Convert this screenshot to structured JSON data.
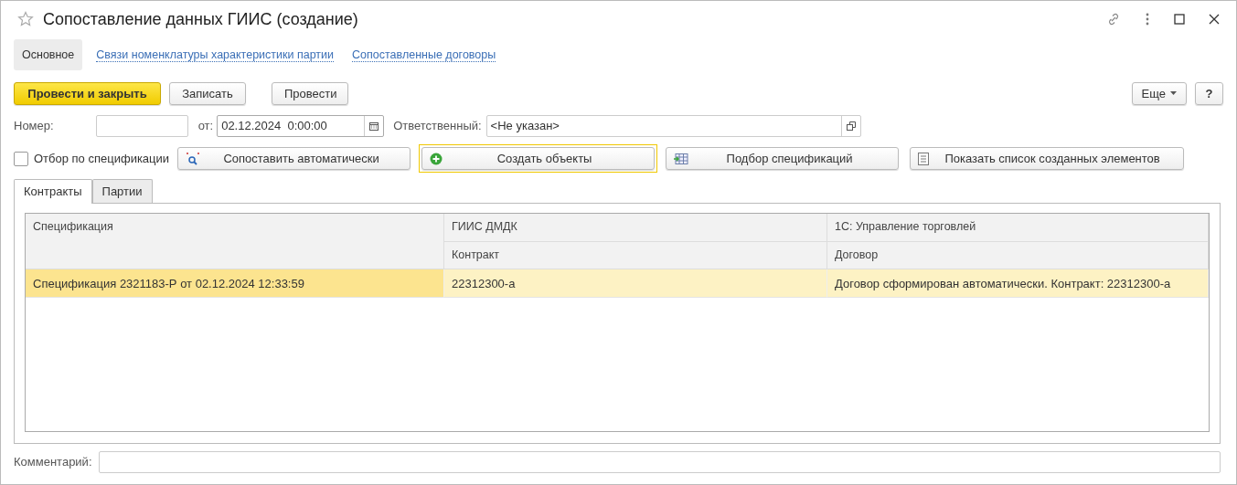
{
  "window": {
    "title": "Сопоставление данных ГИИС (создание)"
  },
  "sections": [
    {
      "label": "Основное",
      "selected": true
    },
    {
      "label": "Связи номенклатуры характеристики партии",
      "selected": false
    },
    {
      "label": "Сопоставленные договоры",
      "selected": false
    }
  ],
  "toolbar": {
    "buttons": [
      {
        "label": "Провести и закрыть",
        "kind": "primary"
      },
      {
        "label": "Записать",
        "kind": "normal"
      },
      {
        "label": "Провести",
        "kind": "normal"
      }
    ],
    "more": "Еще",
    "help": "?"
  },
  "fields": {
    "number": {
      "label": "Номер:"
    },
    "date": {
      "label": "от:",
      "value": "02.12.2024  0:00:00"
    },
    "responsible": {
      "label": "Ответственный:",
      "value": "<Не указан>"
    }
  },
  "filter": {
    "label": "Отбор по спецификации",
    "checked": false
  },
  "actions": [
    {
      "label": "Сопоставить автоматически",
      "kind": "match",
      "focused": false
    },
    {
      "label": "Создать объекты",
      "kind": "create",
      "focused": true
    },
    {
      "label": "Подбор спецификаций",
      "kind": "select",
      "focused": false
    },
    {
      "label": "Показать список созданных элементов",
      "kind": "list",
      "focused": false
    }
  ],
  "tabs": [
    {
      "label": "Контракты",
      "selected": true
    },
    {
      "label": "Партии",
      "selected": false
    }
  ],
  "table": {
    "columns": [
      {
        "label": "Спецификация"
      },
      {
        "group": "ГИИС ДМДК",
        "label": "Контракт"
      },
      {
        "group": "1С: Управление торговлей",
        "label": "Договор"
      }
    ],
    "rows": [
      {
        "selected": true,
        "cells": [
          "Спецификация 2321183-Р от 02.12.2024 12:33:59",
          "22312300-а",
          "Договор сформирован автоматически. Контракт: 22312300-а"
        ]
      }
    ]
  },
  "comment": {
    "label": "Комментарий:"
  }
}
